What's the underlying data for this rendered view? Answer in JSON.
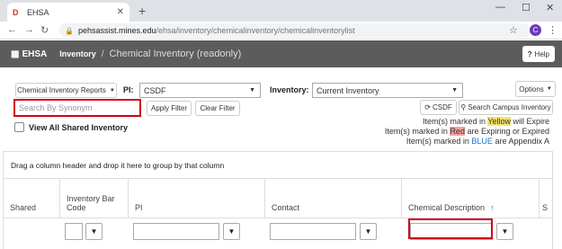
{
  "browser": {
    "tab_title": "EHSA",
    "url_host": "pehsassist.mines.edu",
    "url_path": "/ehsa/inventory/chemicalinventory/chemicalinventorylist",
    "profile_initial": "C"
  },
  "navbar": {
    "brand": "EHSA",
    "crumb_parent": "Inventory",
    "crumb_separator": "/",
    "crumb_current": "Chemical Inventory (readonly)",
    "help_label": "Help"
  },
  "toolbar": {
    "reports_label": "Chemical Inventory Reports",
    "pi_label": "PI:",
    "pi_value": "CSDF",
    "inventory_label": "Inventory:",
    "inventory_value": "Current Inventory",
    "options_label": "Options",
    "search_placeholder": "Search By Synonym",
    "apply_filter": "Apply Filter",
    "clear_filter": "Clear Filter",
    "csdf_button": "CSDF",
    "search_campus": "Search Campus Inventory",
    "view_all_shared": "View All Shared Inventory"
  },
  "legend": {
    "line1_pre": "Item(s) marked in ",
    "line1_hl": "Yellow",
    "line1_post": " will Expire",
    "line2_pre": "Item(s) marked in ",
    "line2_hl": "Red",
    "line2_post": " are Expiring or Expired",
    "line3_pre": "Item(s) marked in ",
    "line3_hl": "BLUE",
    "line3_post": " are Appendix A"
  },
  "grid": {
    "group_hint": "Drag a column header and drop it here to group by that column",
    "columns": {
      "shared": "Shared",
      "barcode": "Inventory Bar Code",
      "pi": "PI",
      "contact": "Contact",
      "description": "Chemical Description",
      "next": "S"
    }
  },
  "icons": {
    "filter": "funnel-icon",
    "sort": "sort-ascending-icon"
  }
}
